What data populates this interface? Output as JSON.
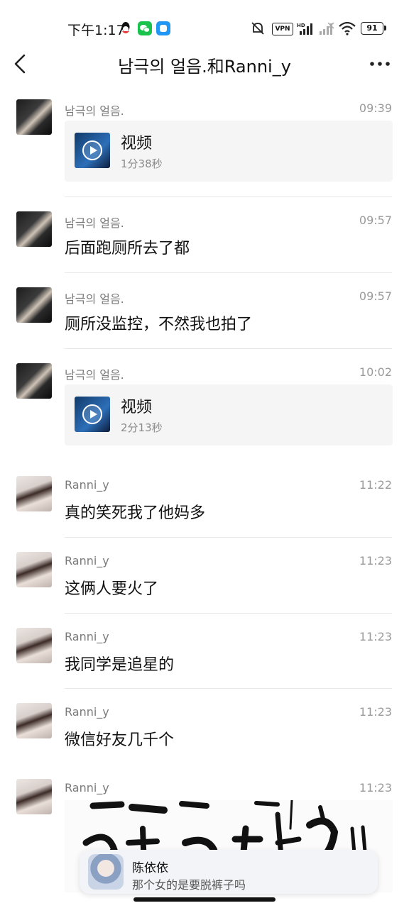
{
  "status_bar": {
    "time": "下午1:17",
    "vpn": "VPN",
    "battery": "91"
  },
  "header": {
    "title": "남극의 얼음.和Ranni_y"
  },
  "messages": [
    {
      "sender": "남극의 얼음.",
      "time": "09:39",
      "type": "video",
      "video_label": "视频",
      "duration": "1分38秒"
    },
    {
      "sender": "남극의 얼음.",
      "time": "09:57",
      "type": "text",
      "text": "后面跑厕所去了都"
    },
    {
      "sender": "남극의 얼음.",
      "time": "09:57",
      "type": "text",
      "text": "厕所没监控，不然我也拍了"
    },
    {
      "sender": "남극의 얼음.",
      "time": "10:02",
      "type": "video",
      "video_label": "视频",
      "duration": "2分13秒"
    },
    {
      "sender": "Ranni_y",
      "time": "11:22",
      "type": "text",
      "text": "真的笑死我了他妈多"
    },
    {
      "sender": "Ranni_y",
      "time": "11:23",
      "type": "text",
      "text": "这俩人要火了"
    },
    {
      "sender": "Ranni_y",
      "time": "11:23",
      "type": "text",
      "text": "我同学是追星的"
    },
    {
      "sender": "Ranni_y",
      "time": "11:23",
      "type": "text",
      "text": "微信好友几千个"
    },
    {
      "sender": "Ranni_y",
      "time": "11:23",
      "type": "image"
    }
  ],
  "notification": {
    "name": "陈依依",
    "message": "那个女的是要脱裤子吗"
  },
  "colors": {
    "wechat_green": "#19c24d",
    "app_blue": "#2196f3"
  }
}
